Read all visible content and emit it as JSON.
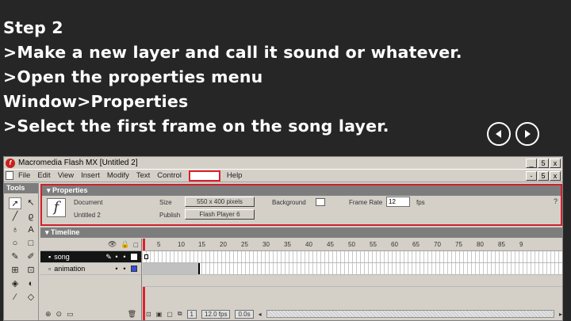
{
  "slide": {
    "lines": [
      "Step 2",
      ">Make a new layer and call it sound or whatever.",
      ">Open the properties menu",
      "Window>Properties",
      ">Select the first frame on the song layer."
    ],
    "nav": {
      "prev_icon": "back-arrow-icon",
      "next_icon": "forward-arrow-icon"
    }
  },
  "window": {
    "title": "Macromedia Flash MX   [Untitled 2]",
    "controls": {
      "minimize": "_",
      "maximize": "5",
      "close": "x"
    },
    "doc_controls": {
      "minimize": "-",
      "restore": "5",
      "close": "x"
    }
  },
  "menu": [
    "File",
    "Edit",
    "View",
    "Insert",
    "Modify",
    "Text",
    "Control",
    "Help"
  ],
  "tools_panel": {
    "title": "Tools"
  },
  "properties": {
    "title": "Properties",
    "document_label": "Document",
    "doc_name": "Untitled 2",
    "size_label": "Size",
    "size_value": "550 x 400 pixels",
    "publish_label": "Publish",
    "publish_value": "Flash Player 6",
    "background_label": "Background",
    "frame_rate_label": "Frame Rate",
    "frame_rate_value": "12",
    "fps_unit": "fps"
  },
  "timeline": {
    "title": "Timeline",
    "ruler": [
      "1",
      "5",
      "10",
      "15",
      "20",
      "25",
      "30",
      "35",
      "40",
      "45",
      "50",
      "55",
      "60",
      "65",
      "70",
      "75",
      "80",
      "85",
      "9"
    ],
    "layers": [
      {
        "name": "song",
        "selected": true,
        "color": "#ffffff"
      },
      {
        "name": "animation",
        "selected": false,
        "color": "#3050e0"
      }
    ],
    "status": {
      "frame": "1",
      "fps": "12.0 fps",
      "time": "0.0s"
    }
  },
  "colors": {
    "highlight": "#e0202a",
    "slide_bg": "#262626"
  }
}
